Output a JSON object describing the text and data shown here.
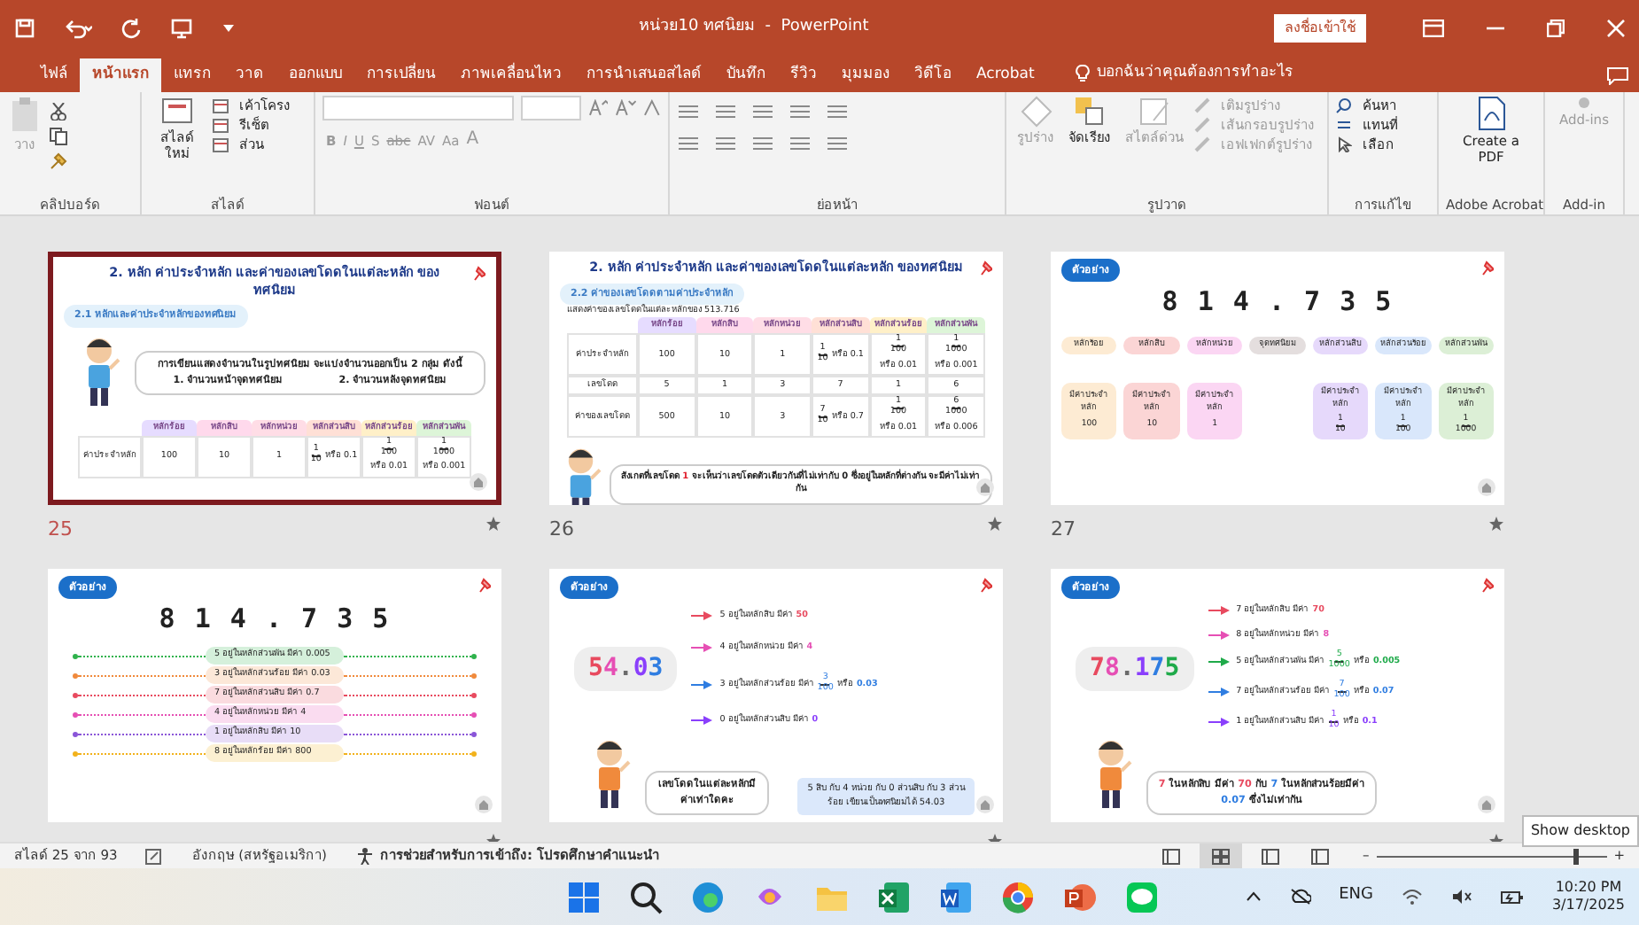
{
  "title_bar": {
    "title": "หน่วย10 ทศนิยม  -  PowerPoint",
    "signin_button": "ลงชื่อเข้าใช้"
  },
  "ribbon_tabs": [
    {
      "label": "ไฟล์",
      "selected": false
    },
    {
      "label": "หน้าแรก",
      "selected": true
    },
    {
      "label": "แทรก",
      "selected": false
    },
    {
      "label": "วาด",
      "selected": false
    },
    {
      "label": "ออกแบบ",
      "selected": false
    },
    {
      "label": "การเปลี่ยน",
      "selected": false
    },
    {
      "label": "ภาพเคลื่อนไหว",
      "selected": false
    },
    {
      "label": "การนำเสนอสไลด์",
      "selected": false
    },
    {
      "label": "บันทึก",
      "selected": false
    },
    {
      "label": "รีวิว",
      "selected": false
    },
    {
      "label": "มุมมอง",
      "selected": false
    },
    {
      "label": "วิดีโอ",
      "selected": false
    },
    {
      "label": "Acrobat",
      "selected": false
    }
  ],
  "tell_me": "บอกฉันว่าคุณต้องการทำอะไร",
  "ribbon_groups": [
    {
      "kind": "clipboard",
      "label": "คลิปบอร์ด",
      "buttons": [
        {
          "label": "วาง",
          "disabled": true
        }
      ]
    },
    {
      "kind": "slides",
      "label": "สไลด์",
      "buttons": [
        {
          "label": "สไลด์ใหม่",
          "disabled": false
        },
        {
          "label": "เค้าโครง",
          "disabled": false
        },
        {
          "label": "รีเซ็ต",
          "disabled": false
        },
        {
          "label": "ส่วน",
          "disabled": false
        }
      ]
    },
    {
      "kind": "font",
      "label": "ฟอนต์",
      "buttons": [
        {
          "label": "B",
          "disabled": true
        },
        {
          "label": "I",
          "disabled": true
        },
        {
          "label": "U",
          "disabled": true
        },
        {
          "label": "S",
          "disabled": true
        },
        {
          "label": "abc",
          "disabled": true
        },
        {
          "label": "AV",
          "disabled": true
        },
        {
          "label": "Aa",
          "disabled": true
        },
        {
          "label": "A",
          "disabled": true
        }
      ]
    },
    {
      "kind": "paragraph",
      "label": "ย่อหน้า"
    },
    {
      "kind": "drawing",
      "label": "รูปวาด",
      "buttons": [
        {
          "label": "รูปร่าง",
          "disabled": true
        },
        {
          "label": "จัดเรียง",
          "disabled": false
        },
        {
          "label": "สไตล์ด่วน",
          "disabled": true
        },
        {
          "label": "เติมรูปร่าง",
          "disabled": true
        },
        {
          "label": "เส้นกรอบรูปร่าง",
          "disabled": true
        },
        {
          "label": "เอฟเฟกต์รูปร่าง",
          "disabled": true
        }
      ]
    },
    {
      "kind": "editing",
      "label": "การแก้ไข",
      "buttons": [
        {
          "label": "ค้นหา",
          "disabled": false
        },
        {
          "label": "แทนที่",
          "disabled": false
        },
        {
          "label": "เลือก",
          "disabled": false
        }
      ]
    },
    {
      "kind": "acrobat",
      "label": "Adobe Acrobat",
      "buttons": [
        {
          "label": "Create a PDF",
          "disabled": false
        }
      ]
    },
    {
      "kind": "addin",
      "label": "Add-in",
      "buttons": [
        {
          "label": "Add-ins",
          "disabled": true
        }
      ]
    }
  ],
  "slides": [
    {
      "number": "25",
      "selected": true,
      "kind": "table_intro",
      "title": "2. หลัก ค่าประจำหลัก และค่าของเลขโดดในแต่ละหลัก ของทศนิยม",
      "subtitle": "2.1 หลักและค่าประจำหลักของทศนิยม",
      "bubble": "การเขียนแสดงจำนวนในรูปทศนิยม จะแบ่งจำนวนออกเป็น 2 กลุ่ม ดังนี้",
      "bubble_items": [
        "1. จำนวนหน้าจุดทศนิยม",
        "2. จำนวนหลังจุดทศนิยม"
      ],
      "headers": [
        {
          "text": "หลักร้อย",
          "color": "#e6dcff"
        },
        {
          "text": "หลักสิบ",
          "color": "#ffd9ec"
        },
        {
          "text": "หลักหน่วย",
          "color": "#ffdde6"
        },
        {
          "text": "หลักส่วนสิบ",
          "color": "#ffe0d6"
        },
        {
          "text": "หลักส่วนร้อย",
          "color": "#fff0c8"
        },
        {
          "text": "หลักส่วนพัน",
          "color": "#ddf5d8"
        }
      ],
      "rows": [
        {
          "label": "ค่าประจำหลัก",
          "cells": [
            {
              "text": "100"
            },
            {
              "text": "10"
            },
            {
              "text": "1"
            },
            {
              "num": "1",
              "den": "10",
              "tail": "หรือ 0.1"
            },
            {
              "num": "1",
              "den": "100",
              "tail": "หรือ 0.01"
            },
            {
              "num": "1",
              "den": "1000",
              "tail": "หรือ 0.001"
            }
          ]
        }
      ]
    },
    {
      "number": "26",
      "selected": false,
      "kind": "table_values",
      "title": "2. หลัก ค่าประจำหลัก และค่าของเลขโดดในแต่ละหลัก ของทศนิยม",
      "subtitle": "2.2 ค่าของเลขโดดตามค่าประจำหลัก",
      "caption": "แสดงค่าของเลขโดดในแต่ละหลักของ 513.716",
      "headers": [
        {
          "text": "หลักร้อย",
          "color": "#e6dcff"
        },
        {
          "text": "หลักสิบ",
          "color": "#ffd9ec"
        },
        {
          "text": "หลักหน่วย",
          "color": "#ffdde6"
        },
        {
          "text": "หลักส่วนสิบ",
          "color": "#ffe0d6"
        },
        {
          "text": "หลักส่วนร้อย",
          "color": "#fff0c8"
        },
        {
          "text": "หลักส่วนพัน",
          "color": "#ddf5d8"
        }
      ],
      "rows": [
        {
          "label": "ค่าประจำหลัก",
          "cells": [
            {
              "text": "100"
            },
            {
              "text": "10"
            },
            {
              "text": "1"
            },
            {
              "num": "1",
              "den": "10",
              "tail": "หรือ 0.1"
            },
            {
              "num": "1",
              "den": "100",
              "tail": "หรือ 0.01"
            },
            {
              "num": "1",
              "den": "1000",
              "tail": "หรือ 0.001"
            }
          ]
        },
        {
          "label": "เลขโดด",
          "cells": [
            {
              "text": "5"
            },
            {
              "text": "1"
            },
            {
              "text": "3"
            },
            {
              "text": "7"
            },
            {
              "text": "1"
            },
            {
              "text": "6"
            }
          ]
        },
        {
          "label": "ค่าของเลขโดด",
          "cells": [
            {
              "text": "500"
            },
            {
              "text": "10"
            },
            {
              "text": "3"
            },
            {
              "num": "7",
              "den": "10",
              "tail": "หรือ 0.7"
            },
            {
              "num": "1",
              "den": "100",
              "tail": "หรือ 0.01"
            },
            {
              "num": "6",
              "den": "1000",
              "tail": "หรือ 0.006"
            }
          ]
        }
      ],
      "note": [
        {
          "text": "สังเกตที่เลขโดด "
        },
        {
          "text": "1",
          "color": "#e0202e"
        },
        {
          "text": " จะเห็นว่าเลขโดดตัวเดียวกันที่ไม่เท่ากับ 0 ซึ่งอยู่ในหลักที่ต่างกัน จะมีค่าไม่เท่ากัน"
        }
      ]
    },
    {
      "number": "27",
      "selected": false,
      "kind": "place_diagram",
      "badge": "ตัวอย่าง",
      "digits": "8 1 4 . 7 3 5",
      "places": [
        {
          "label": "หลักร้อย",
          "color": "#fdebd3",
          "caption": "มีค่าประจำหลัก",
          "value": "100"
        },
        {
          "label": "หลักสิบ",
          "color": "#fbd5d5",
          "caption": "มีค่าประจำหลัก",
          "value": "10"
        },
        {
          "label": "หลักหน่วย",
          "color": "#fbd6f3",
          "caption": "มีค่าประจำหลัก",
          "value": "1"
        },
        {
          "label": "จุดทศนิยม",
          "color": "#e4dede"
        },
        {
          "label": "หลักส่วนสิบ",
          "color": "#e6d9fb",
          "caption": "มีค่าประจำหลัก",
          "num": "1",
          "den": "10"
        },
        {
          "label": "หลักส่วนร้อย",
          "color": "#d9e7fb",
          "caption": "มีค่าประจำหลัก",
          "num": "1",
          "den": "100"
        },
        {
          "label": "หลักส่วนพัน",
          "color": "#dcefd6",
          "caption": "มีค่าประจำหลัก",
          "num": "1",
          "den": "1000"
        }
      ]
    },
    {
      "selected": false,
      "kind": "digit_lines",
      "badge": "ตัวอย่าง",
      "digits": "8 1 4 . 7 3 5",
      "lines": [
        {
          "text": "5 อยู่ในหลักส่วนพัน  มีค่า 0.005",
          "color": "#2fb24c"
        },
        {
          "text": "3 อยู่ในหลักส่วนร้อย  มีค่า 0.03",
          "color": "#f08a3c"
        },
        {
          "text": "7 อยู่ในหลักส่วนสิบ  มีค่า 0.7",
          "color": "#e84a5f"
        },
        {
          "text": "4 อยู่ในหลักหน่วย   มีค่า 4",
          "color": "#e64fb4"
        },
        {
          "text": "1 อยู่ในหลักสิบ   มีค่า 10",
          "color": "#8a55d8"
        },
        {
          "text": "8 อยู่ในหลักร้อย   มีค่า 800",
          "color": "#f2b21c"
        }
      ]
    },
    {
      "selected": false,
      "kind": "digit_callouts",
      "badge": "ตัวอย่าง",
      "digits": [
        {
          "char": "5",
          "color": "#e84a5f"
        },
        {
          "char": "4",
          "color": "#e64fb4"
        },
        {
          "char": ".",
          "color": "#6b6b6b"
        },
        {
          "char": "0",
          "color": "#8a3ffc"
        },
        {
          "char": "3",
          "color": "#2f7de1"
        }
      ],
      "callouts": [
        {
          "text": "5 อยู่ในหลักสิบ มีค่า",
          "value": "50",
          "color": "#e84a5f"
        },
        {
          "text": "4 อยู่ในหลักหน่วย มีค่า",
          "value": "4",
          "color": "#e64fb4"
        },
        {
          "text": "3 อยู่ในหลักส่วนร้อย มีค่า",
          "num": "3",
          "den": "100",
          "tail": "หรือ",
          "value": "0.03",
          "color": "#2f7de1"
        },
        {
          "text": "0 อยู่ในหลักส่วนสิบ มีค่า",
          "value": "0",
          "color": "#8a3ffc"
        }
      ],
      "bubble": [
        {
          "text": "เลขโดดในแต่ละหลักมีค่าเท่าใดคะ"
        }
      ],
      "summary": "5 สิบ กับ 4 หน่วย กับ 0 ส่วนสิบ กับ 3 ส่วนร้อย เขียนเป็นทศนิยมได้ 54.03"
    },
    {
      "selected": false,
      "kind": "digit_callouts",
      "badge": "ตัวอย่าง",
      "digits": [
        {
          "char": "7",
          "color": "#e84a5f"
        },
        {
          "char": "8",
          "color": "#e64fb4"
        },
        {
          "char": ".",
          "color": "#6b6b6b"
        },
        {
          "char": "1",
          "color": "#8a3ffc"
        },
        {
          "char": "7",
          "color": "#2f7de1"
        },
        {
          "char": "5",
          "color": "#1faa4a"
        }
      ],
      "callouts": [
        {
          "text": "7 อยู่ในหลักสิบ มีค่า",
          "value": "70",
          "color": "#e84a5f"
        },
        {
          "text": "8 อยู่ในหลักหน่วย มีค่า",
          "value": "8",
          "color": "#e64fb4"
        },
        {
          "text": "5 อยู่ในหลักส่วนพัน มีค่า",
          "num": "5",
          "den": "1000",
          "tail": "หรือ",
          "value": "0.005",
          "color": "#1faa4a"
        },
        {
          "text": "7 อยู่ในหลักส่วนร้อย มีค่า",
          "num": "7",
          "den": "100",
          "tail": "หรือ",
          "value": "0.07",
          "color": "#2f7de1"
        },
        {
          "text": "1 อยู่ในหลักส่วนสิบ มีค่า",
          "num": "1",
          "den": "10",
          "tail": "หรือ",
          "value": "0.1",
          "color": "#8a3ffc"
        }
      ],
      "bubble": [
        {
          "text": "7",
          "color": "#e84a5f"
        },
        {
          "text": " ในหลักสิบ มีค่า "
        },
        {
          "text": "70",
          "color": "#e84a5f"
        },
        {
          "text": " กับ "
        },
        {
          "text": "7",
          "color": "#2f7de1"
        },
        {
          "text": " ในหลักส่วนร้อยมีค่า "
        },
        {
          "text": "0.07",
          "color": "#2f7de1"
        },
        {
          "text": " ซึ่งไม่เท่ากัน"
        }
      ]
    }
  ],
  "status_bar": {
    "slide_count": "สไลด์ 25 จาก 93",
    "language": "อังกฤษ (สหรัฐอเมริกา)",
    "accessibility": "การช่วยสำหรับการเข้าถึง: โปรดศึกษาคำแนะนำ",
    "view_buttons": [
      {
        "selected": false
      },
      {
        "selected": true
      },
      {
        "selected": false
      },
      {
        "selected": false
      }
    ],
    "zoom_out": "–",
    "zoom_in": "+",
    "zoom_slider": {
      "level": 0.88
    }
  },
  "tooltip": "Show desktop",
  "taskbar": {
    "language": "ENG",
    "time": "10:20 PM",
    "date": "3/17/2025"
  }
}
